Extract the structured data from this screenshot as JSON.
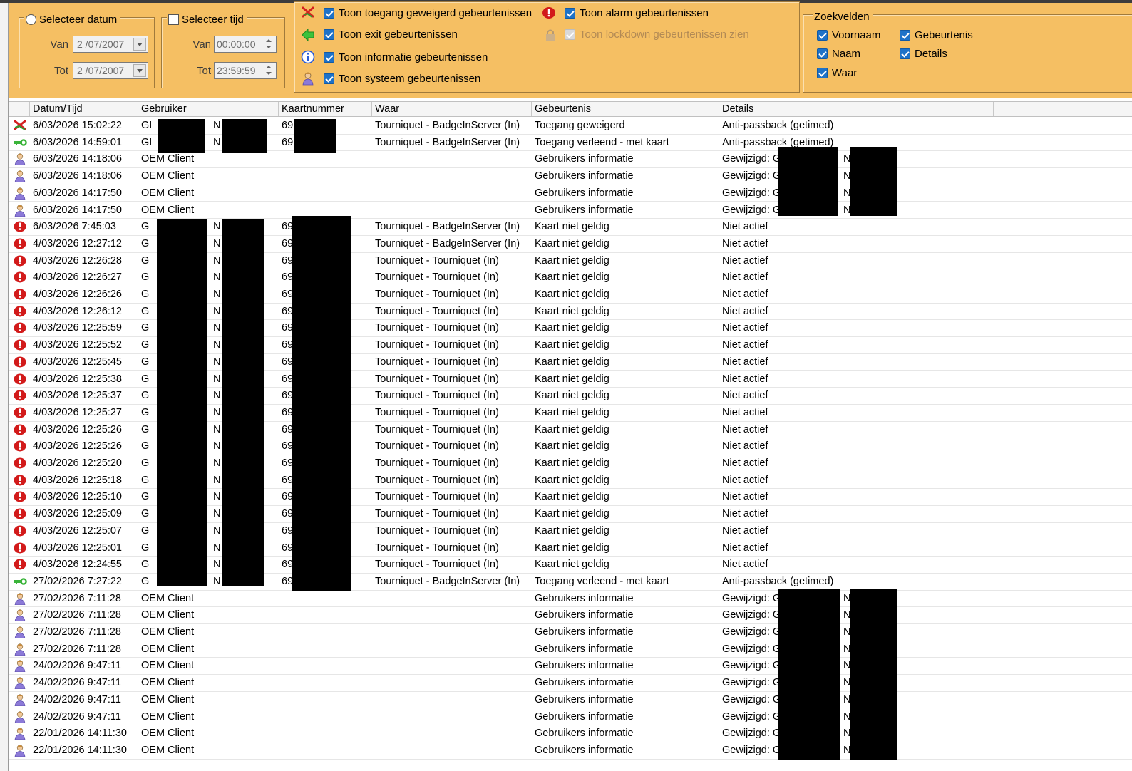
{
  "filters": {
    "date_group": {
      "label": "Selecteer datum",
      "van_label": "Van",
      "tot_label": "Tot",
      "van_value": "2 /07/2007",
      "tot_value": "2 /07/2007"
    },
    "time_group": {
      "label": "Selecteer tijd",
      "van_label": "Van",
      "tot_label": "Tot",
      "van_value": "00:00:00",
      "tot_value": "23:59:59"
    },
    "event_toggles": [
      {
        "icon": "access-denied-icon",
        "label": "Toon toegang geweigerd gebeurtenissen",
        "checked": true
      },
      {
        "icon": "exit-arrow-icon",
        "label": "Toon exit gebeurtenissen",
        "checked": true
      },
      {
        "icon": "info-icon",
        "label": "Toon informatie gebeurtenissen",
        "checked": true
      },
      {
        "icon": "system-user-icon",
        "label": "Toon systeem gebeurtenissen",
        "checked": true
      },
      {
        "icon": "alarm-icon",
        "label": "Toon alarm gebeurtenissen",
        "checked": true
      },
      {
        "icon": "lock-icon",
        "label": "Toon lockdown gebeurtenissen zien",
        "checked": true,
        "disabled": true
      }
    ],
    "search_fields": {
      "label": "Zoekvelden",
      "items": [
        {
          "label": "Voornaam",
          "checked": true
        },
        {
          "label": "Naam",
          "checked": true
        },
        {
          "label": "Waar",
          "checked": true
        },
        {
          "label": "Gebeurtenis",
          "checked": true
        },
        {
          "label": "Details",
          "checked": true
        }
      ]
    }
  },
  "grid": {
    "columns": [
      "Datum/Tijd",
      "Gebruiker",
      "Kaartnummer",
      "Waar",
      "Gebeurtenis",
      "Details"
    ],
    "rows": [
      {
        "icon": "access-denied-icon",
        "datetime": "6/03/2026  15:02:22",
        "user": "GI",
        "user_n": "N",
        "card": "69",
        "where": "Tourniquet - BadgeInServer (In)",
        "event": "Toegang geweigerd",
        "details": "Anti-passback (getimed)"
      },
      {
        "icon": "access-granted-key-icon",
        "datetime": "6/03/2026  14:59:01",
        "user": "GI",
        "user_n": "N",
        "card": "69",
        "where": "Tourniquet - BadgeInServer (In)",
        "event": "Toegang verleend - met kaart",
        "details": "Anti-passback (getimed)"
      },
      {
        "icon": "system-user-icon",
        "datetime": "6/03/2026  14:18:06",
        "user": "OEM Client",
        "card": "",
        "where": "",
        "event": "Gebruikers informatie",
        "details": "Gewijzigd: G",
        "details_n": "N"
      },
      {
        "icon": "system-user-icon",
        "datetime": "6/03/2026  14:18:06",
        "user": "OEM Client",
        "card": "",
        "where": "",
        "event": "Gebruikers informatie",
        "details": "Gewijzigd: G",
        "details_n": "N"
      },
      {
        "icon": "system-user-icon",
        "datetime": "6/03/2026  14:17:50",
        "user": "OEM Client",
        "card": "",
        "where": "",
        "event": "Gebruikers informatie",
        "details": "Gewijzigd: G",
        "details_n": "N"
      },
      {
        "icon": "system-user-icon",
        "datetime": "6/03/2026  14:17:50",
        "user": "OEM Client",
        "card": "",
        "where": "",
        "event": "Gebruikers informatie",
        "details": "Gewijzigd: G",
        "details_n": "N"
      },
      {
        "icon": "alarm-icon",
        "datetime": "6/03/2026  7:45:03",
        "user": "G",
        "user_n": "N",
        "card": "69",
        "where": "Tourniquet - BadgeInServer (In)",
        "event": "Kaart niet geldig",
        "details": "Niet actief"
      },
      {
        "icon": "alarm-icon",
        "datetime": "4/03/2026  12:27:12",
        "user": "G",
        "user_n": "N",
        "card": "69",
        "where": "Tourniquet - BadgeInServer (In)",
        "event": "Kaart niet geldig",
        "details": "Niet actief"
      },
      {
        "icon": "alarm-icon",
        "datetime": "4/03/2026  12:26:28",
        "user": "G",
        "user_n": "N",
        "card": "69",
        "where": "Tourniquet - Tourniquet (In)",
        "event": "Kaart niet geldig",
        "details": "Niet actief"
      },
      {
        "icon": "alarm-icon",
        "datetime": "4/03/2026  12:26:27",
        "user": "G",
        "user_n": "N",
        "card": "69",
        "where": "Tourniquet - Tourniquet (In)",
        "event": "Kaart niet geldig",
        "details": "Niet actief"
      },
      {
        "icon": "alarm-icon",
        "datetime": "4/03/2026  12:26:26",
        "user": "G",
        "user_n": "N",
        "card": "69",
        "where": "Tourniquet - Tourniquet (In)",
        "event": "Kaart niet geldig",
        "details": "Niet actief"
      },
      {
        "icon": "alarm-icon",
        "datetime": "4/03/2026  12:26:12",
        "user": "G",
        "user_n": "N",
        "card": "69",
        "where": "Tourniquet - Tourniquet (In)",
        "event": "Kaart niet geldig",
        "details": "Niet actief"
      },
      {
        "icon": "alarm-icon",
        "datetime": "4/03/2026  12:25:59",
        "user": "G",
        "user_n": "N",
        "card": "69",
        "where": "Tourniquet - Tourniquet (In)",
        "event": "Kaart niet geldig",
        "details": "Niet actief"
      },
      {
        "icon": "alarm-icon",
        "datetime": "4/03/2026  12:25:52",
        "user": "G",
        "user_n": "N",
        "card": "69",
        "where": "Tourniquet - Tourniquet (In)",
        "event": "Kaart niet geldig",
        "details": "Niet actief"
      },
      {
        "icon": "alarm-icon",
        "datetime": "4/03/2026  12:25:45",
        "user": "G",
        "user_n": "N",
        "card": "69",
        "where": "Tourniquet - Tourniquet (In)",
        "event": "Kaart niet geldig",
        "details": "Niet actief"
      },
      {
        "icon": "alarm-icon",
        "datetime": "4/03/2026  12:25:38",
        "user": "G",
        "user_n": "N",
        "card": "69",
        "where": "Tourniquet - Tourniquet (In)",
        "event": "Kaart niet geldig",
        "details": "Niet actief"
      },
      {
        "icon": "alarm-icon",
        "datetime": "4/03/2026  12:25:37",
        "user": "G",
        "user_n": "N",
        "card": "69",
        "where": "Tourniquet - Tourniquet (In)",
        "event": "Kaart niet geldig",
        "details": "Niet actief"
      },
      {
        "icon": "alarm-icon",
        "datetime": "4/03/2026  12:25:27",
        "user": "G",
        "user_n": "N",
        "card": "69",
        "where": "Tourniquet - Tourniquet (In)",
        "event": "Kaart niet geldig",
        "details": "Niet actief"
      },
      {
        "icon": "alarm-icon",
        "datetime": "4/03/2026  12:25:26",
        "user": "G",
        "user_n": "N",
        "card": "69",
        "where": "Tourniquet - Tourniquet (In)",
        "event": "Kaart niet geldig",
        "details": "Niet actief"
      },
      {
        "icon": "alarm-icon",
        "datetime": "4/03/2026  12:25:26",
        "user": "G",
        "user_n": "N",
        "card": "69",
        "where": "Tourniquet - Tourniquet (In)",
        "event": "Kaart niet geldig",
        "details": "Niet actief"
      },
      {
        "icon": "alarm-icon",
        "datetime": "4/03/2026  12:25:20",
        "user": "G",
        "user_n": "N",
        "card": "69",
        "where": "Tourniquet - Tourniquet (In)",
        "event": "Kaart niet geldig",
        "details": "Niet actief"
      },
      {
        "icon": "alarm-icon",
        "datetime": "4/03/2026  12:25:18",
        "user": "G",
        "user_n": "N",
        "card": "69",
        "where": "Tourniquet - Tourniquet (In)",
        "event": "Kaart niet geldig",
        "details": "Niet actief"
      },
      {
        "icon": "alarm-icon",
        "datetime": "4/03/2026  12:25:10",
        "user": "G",
        "user_n": "N",
        "card": "69",
        "where": "Tourniquet - Tourniquet (In)",
        "event": "Kaart niet geldig",
        "details": "Niet actief"
      },
      {
        "icon": "alarm-icon",
        "datetime": "4/03/2026  12:25:09",
        "user": "G",
        "user_n": "N",
        "card": "69",
        "where": "Tourniquet - Tourniquet (In)",
        "event": "Kaart niet geldig",
        "details": "Niet actief"
      },
      {
        "icon": "alarm-icon",
        "datetime": "4/03/2026  12:25:07",
        "user": "G",
        "user_n": "N",
        "card": "69",
        "where": "Tourniquet - Tourniquet (In)",
        "event": "Kaart niet geldig",
        "details": "Niet actief"
      },
      {
        "icon": "alarm-icon",
        "datetime": "4/03/2026  12:25:01",
        "user": "G",
        "user_n": "N",
        "card": "69",
        "where": "Tourniquet - Tourniquet (In)",
        "event": "Kaart niet geldig",
        "details": "Niet actief"
      },
      {
        "icon": "alarm-icon",
        "datetime": "4/03/2026  12:24:55",
        "user": "G",
        "user_n": "N",
        "card": "69",
        "where": "Tourniquet - Tourniquet (In)",
        "event": "Kaart niet geldig",
        "details": "Niet actief"
      },
      {
        "icon": "access-granted-key-icon",
        "datetime": "27/02/2026  7:27:22",
        "user": "G",
        "user_n": "N",
        "card": "69",
        "where": "Tourniquet - BadgeInServer (In)",
        "event": "Toegang verleend - met kaart",
        "details": "Anti-passback (getimed)"
      },
      {
        "icon": "system-user-icon",
        "datetime": "27/02/2026  7:11:28",
        "user": "OEM Client",
        "card": "",
        "where": "",
        "event": "Gebruikers informatie",
        "details": "Gewijzigd: G",
        "details_n": "N"
      },
      {
        "icon": "system-user-icon",
        "datetime": "27/02/2026  7:11:28",
        "user": "OEM Client",
        "card": "",
        "where": "",
        "event": "Gebruikers informatie",
        "details": "Gewijzigd: G",
        "details_n": "N"
      },
      {
        "icon": "system-user-icon",
        "datetime": "27/02/2026  7:11:28",
        "user": "OEM Client",
        "card": "",
        "where": "",
        "event": "Gebruikers informatie",
        "details": "Gewijzigd: G",
        "details_n": "N"
      },
      {
        "icon": "system-user-icon",
        "datetime": "27/02/2026  7:11:28",
        "user": "OEM Client",
        "card": "",
        "where": "",
        "event": "Gebruikers informatie",
        "details": "Gewijzigd: G",
        "details_n": "N"
      },
      {
        "icon": "system-user-icon",
        "datetime": "24/02/2026  9:47:11",
        "user": "OEM Client",
        "card": "",
        "where": "",
        "event": "Gebruikers informatie",
        "details": "Gewijzigd: G",
        "details_n": "N"
      },
      {
        "icon": "system-user-icon",
        "datetime": "24/02/2026  9:47:11",
        "user": "OEM Client",
        "card": "",
        "where": "",
        "event": "Gebruikers informatie",
        "details": "Gewijzigd: G",
        "details_n": "N"
      },
      {
        "icon": "system-user-icon",
        "datetime": "24/02/2026  9:47:11",
        "user": "OEM Client",
        "card": "",
        "where": "",
        "event": "Gebruikers informatie",
        "details": "Gewijzigd: G",
        "details_n": "N"
      },
      {
        "icon": "system-user-icon",
        "datetime": "24/02/2026  9:47:11",
        "user": "OEM Client",
        "card": "",
        "where": "",
        "event": "Gebruikers informatie",
        "details": "Gewijzigd: G",
        "details_n": "N"
      },
      {
        "icon": "system-user-icon",
        "datetime": "22/01/2026  14:11:30",
        "user": "OEM Client",
        "card": "",
        "where": "",
        "event": "Gebruikers informatie",
        "details": "Gewijzigd: G",
        "details_n": "N"
      },
      {
        "icon": "system-user-icon",
        "datetime": "22/01/2026  14:11:30",
        "user": "OEM Client",
        "card": "",
        "where": "",
        "event": "Gebruikers informatie",
        "details": "Gewijzigd: G",
        "details_n": "N"
      }
    ]
  },
  "colors": {
    "filter_bar": "#f5bf63",
    "checkbox_blue": "#1e72c8",
    "alarm_red": "#d21a1a",
    "redaction": "#000000"
  }
}
